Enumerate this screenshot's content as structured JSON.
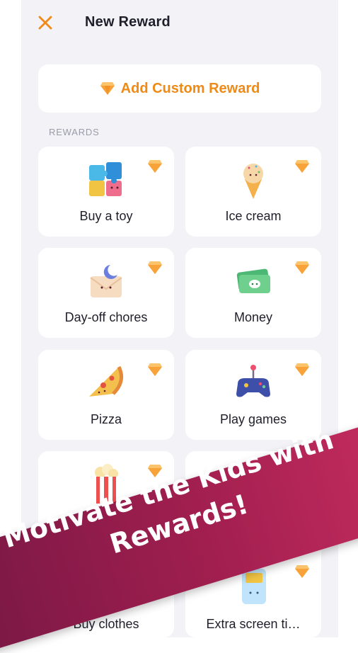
{
  "header": {
    "close_icon": "close-icon",
    "title": "New Reward"
  },
  "custom_reward": {
    "icon": "gem-icon",
    "label": "Add Custom Reward"
  },
  "section_label": "REWARDS",
  "rewards": [
    {
      "name": "Buy a toy",
      "icon": "puzzle-icon"
    },
    {
      "name": "Ice cream",
      "icon": "ice-cream-icon"
    },
    {
      "name": "Day-off chores",
      "icon": "envelope-moon-icon"
    },
    {
      "name": "Money",
      "icon": "money-icon"
    },
    {
      "name": "Pizza",
      "icon": "pizza-icon"
    },
    {
      "name": "Play games",
      "icon": "gamepad-icon"
    },
    {
      "name": "Buy clothes",
      "icon": "popcorn-icon"
    },
    {
      "name": "Extra screen ti…",
      "icon": "tablet-icon"
    }
  ],
  "banner": {
    "line1": "Motivate the Kids with",
    "line2": "Rewards!"
  },
  "colors": {
    "accent": "#f08a16",
    "background": "#f3f3f7",
    "banner": "#a11f4f"
  }
}
